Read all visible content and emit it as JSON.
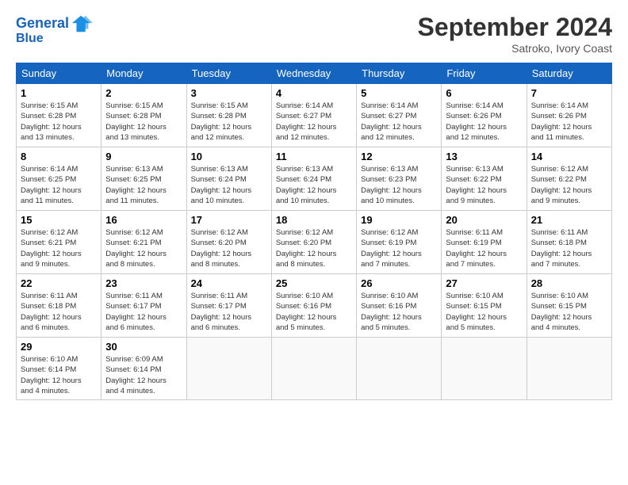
{
  "header": {
    "logo_line1": "General",
    "logo_line2": "Blue",
    "month": "September 2024",
    "location": "Satroko, Ivory Coast"
  },
  "days_of_week": [
    "Sunday",
    "Monday",
    "Tuesday",
    "Wednesday",
    "Thursday",
    "Friday",
    "Saturday"
  ],
  "weeks": [
    [
      {
        "day": "1",
        "info": "Sunrise: 6:15 AM\nSunset: 6:28 PM\nDaylight: 12 hours\nand 13 minutes."
      },
      {
        "day": "2",
        "info": "Sunrise: 6:15 AM\nSunset: 6:28 PM\nDaylight: 12 hours\nand 13 minutes."
      },
      {
        "day": "3",
        "info": "Sunrise: 6:15 AM\nSunset: 6:28 PM\nDaylight: 12 hours\nand 12 minutes."
      },
      {
        "day": "4",
        "info": "Sunrise: 6:14 AM\nSunset: 6:27 PM\nDaylight: 12 hours\nand 12 minutes."
      },
      {
        "day": "5",
        "info": "Sunrise: 6:14 AM\nSunset: 6:27 PM\nDaylight: 12 hours\nand 12 minutes."
      },
      {
        "day": "6",
        "info": "Sunrise: 6:14 AM\nSunset: 6:26 PM\nDaylight: 12 hours\nand 12 minutes."
      },
      {
        "day": "7",
        "info": "Sunrise: 6:14 AM\nSunset: 6:26 PM\nDaylight: 12 hours\nand 11 minutes."
      }
    ],
    [
      {
        "day": "8",
        "info": "Sunrise: 6:14 AM\nSunset: 6:25 PM\nDaylight: 12 hours\nand 11 minutes."
      },
      {
        "day": "9",
        "info": "Sunrise: 6:13 AM\nSunset: 6:25 PM\nDaylight: 12 hours\nand 11 minutes."
      },
      {
        "day": "10",
        "info": "Sunrise: 6:13 AM\nSunset: 6:24 PM\nDaylight: 12 hours\nand 10 minutes."
      },
      {
        "day": "11",
        "info": "Sunrise: 6:13 AM\nSunset: 6:24 PM\nDaylight: 12 hours\nand 10 minutes."
      },
      {
        "day": "12",
        "info": "Sunrise: 6:13 AM\nSunset: 6:23 PM\nDaylight: 12 hours\nand 10 minutes."
      },
      {
        "day": "13",
        "info": "Sunrise: 6:13 AM\nSunset: 6:22 PM\nDaylight: 12 hours\nand 9 minutes."
      },
      {
        "day": "14",
        "info": "Sunrise: 6:12 AM\nSunset: 6:22 PM\nDaylight: 12 hours\nand 9 minutes."
      }
    ],
    [
      {
        "day": "15",
        "info": "Sunrise: 6:12 AM\nSunset: 6:21 PM\nDaylight: 12 hours\nand 9 minutes."
      },
      {
        "day": "16",
        "info": "Sunrise: 6:12 AM\nSunset: 6:21 PM\nDaylight: 12 hours\nand 8 minutes."
      },
      {
        "day": "17",
        "info": "Sunrise: 6:12 AM\nSunset: 6:20 PM\nDaylight: 12 hours\nand 8 minutes."
      },
      {
        "day": "18",
        "info": "Sunrise: 6:12 AM\nSunset: 6:20 PM\nDaylight: 12 hours\nand 8 minutes."
      },
      {
        "day": "19",
        "info": "Sunrise: 6:12 AM\nSunset: 6:19 PM\nDaylight: 12 hours\nand 7 minutes."
      },
      {
        "day": "20",
        "info": "Sunrise: 6:11 AM\nSunset: 6:19 PM\nDaylight: 12 hours\nand 7 minutes."
      },
      {
        "day": "21",
        "info": "Sunrise: 6:11 AM\nSunset: 6:18 PM\nDaylight: 12 hours\nand 7 minutes."
      }
    ],
    [
      {
        "day": "22",
        "info": "Sunrise: 6:11 AM\nSunset: 6:18 PM\nDaylight: 12 hours\nand 6 minutes."
      },
      {
        "day": "23",
        "info": "Sunrise: 6:11 AM\nSunset: 6:17 PM\nDaylight: 12 hours\nand 6 minutes."
      },
      {
        "day": "24",
        "info": "Sunrise: 6:11 AM\nSunset: 6:17 PM\nDaylight: 12 hours\nand 6 minutes."
      },
      {
        "day": "25",
        "info": "Sunrise: 6:10 AM\nSunset: 6:16 PM\nDaylight: 12 hours\nand 5 minutes."
      },
      {
        "day": "26",
        "info": "Sunrise: 6:10 AM\nSunset: 6:16 PM\nDaylight: 12 hours\nand 5 minutes."
      },
      {
        "day": "27",
        "info": "Sunrise: 6:10 AM\nSunset: 6:15 PM\nDaylight: 12 hours\nand 5 minutes."
      },
      {
        "day": "28",
        "info": "Sunrise: 6:10 AM\nSunset: 6:15 PM\nDaylight: 12 hours\nand 4 minutes."
      }
    ],
    [
      {
        "day": "29",
        "info": "Sunrise: 6:10 AM\nSunset: 6:14 PM\nDaylight: 12 hours\nand 4 minutes."
      },
      {
        "day": "30",
        "info": "Sunrise: 6:09 AM\nSunset: 6:14 PM\nDaylight: 12 hours\nand 4 minutes."
      },
      {
        "day": "",
        "info": ""
      },
      {
        "day": "",
        "info": ""
      },
      {
        "day": "",
        "info": ""
      },
      {
        "day": "",
        "info": ""
      },
      {
        "day": "",
        "info": ""
      }
    ]
  ]
}
